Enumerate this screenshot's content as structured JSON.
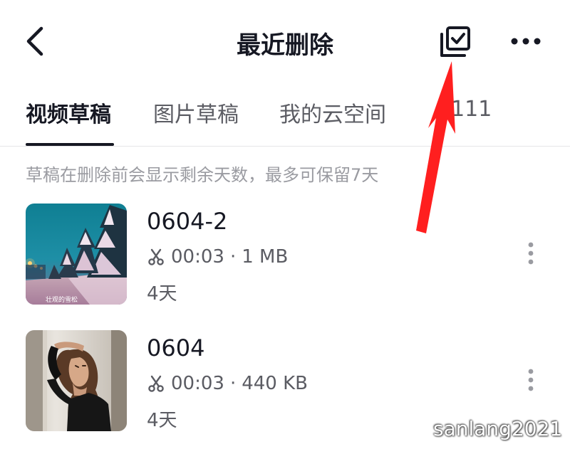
{
  "header": {
    "back_icon": "chevron-left-icon",
    "title": "最近删除",
    "select_icon": "multi-select-checkbox-icon",
    "more_icon": "more-horizontal-icon"
  },
  "tabs": [
    {
      "label": "视频草稿",
      "active": true
    },
    {
      "label": "图片草稿",
      "active": false
    },
    {
      "label": "我的云空间",
      "active": false
    },
    {
      "label": "1111",
      "active": false
    }
  ],
  "notice": "草稿在删除前会显示剩余天数，最多可保留7天",
  "drafts": [
    {
      "name": "0604-2",
      "duration": "00:03",
      "size": "1 MB",
      "days_left": "4天",
      "thumbnail_caption": "壮观的雪松",
      "thumbnail": "snowy-pine-trees-road-night"
    },
    {
      "name": "0604",
      "duration": "00:03",
      "size": "440 KB",
      "days_left": "4天",
      "thumbnail": "woman-portrait-black-jacket"
    }
  ],
  "meta_separator": "·",
  "annotation": {
    "type": "red-arrow",
    "color": "#ff1f1f"
  },
  "watermark": "sanlang2021",
  "colors": {
    "primary_text": "#161823",
    "secondary_text": "#5b5c63",
    "hint_text": "#9a9ba1",
    "divider": "#e6e6e8"
  }
}
